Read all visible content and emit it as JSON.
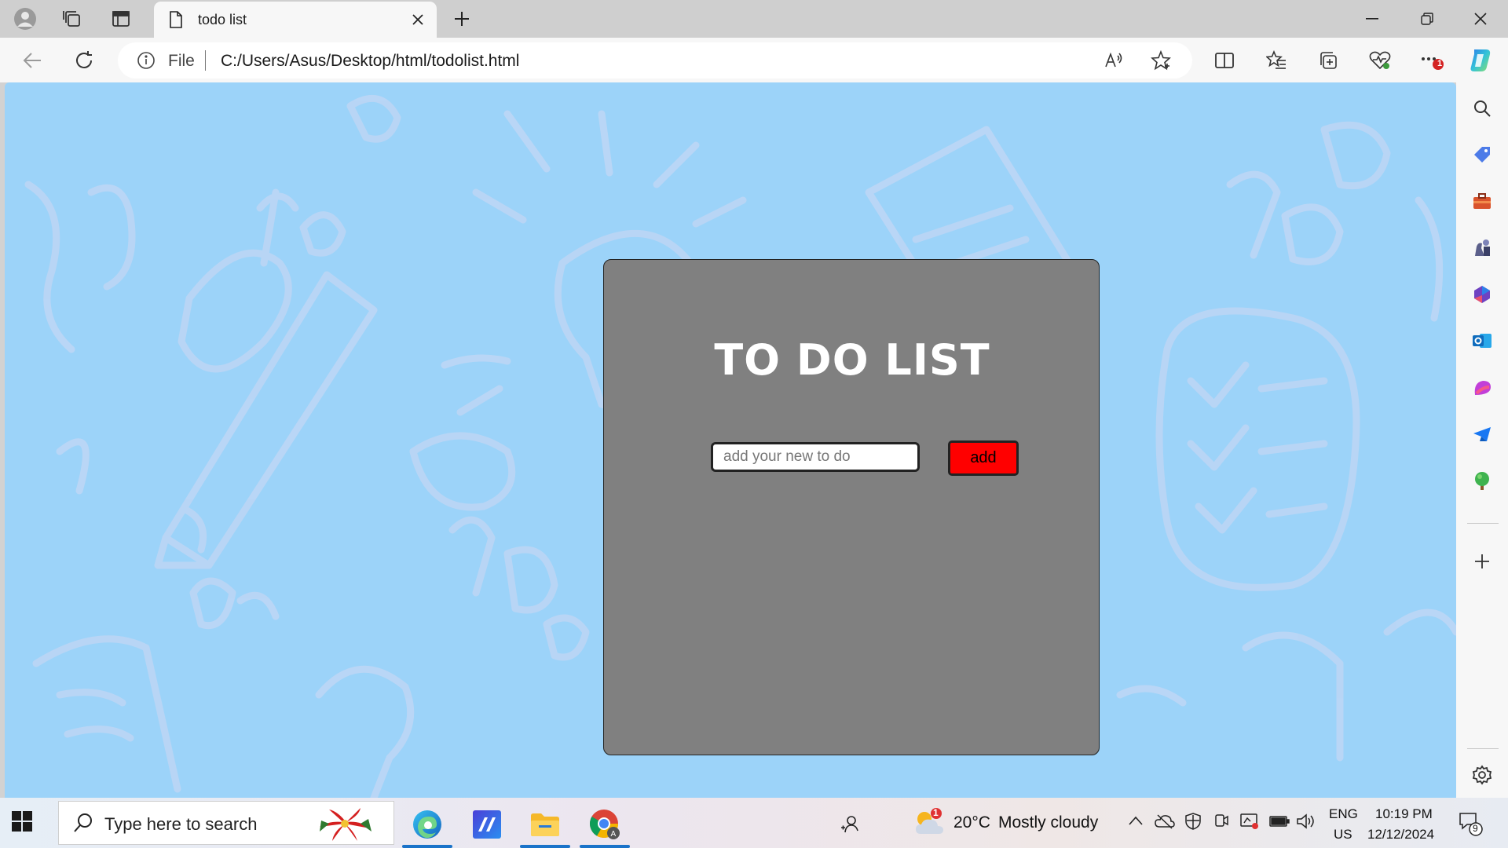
{
  "browser": {
    "tab_title": "todo list",
    "address_prefix": "File",
    "url": "C:/Users/Asus/Desktop/html/todolist.html",
    "notification_badge": "1"
  },
  "page": {
    "title": "TO DO LIST",
    "input_placeholder": "add your new to do",
    "add_label": "add",
    "colors": {
      "background": "#9cd3f9",
      "card": "#808080",
      "add_button": "#ff0000"
    }
  },
  "taskbar": {
    "search_placeholder": "Type here to search",
    "weather_temp": "20°C",
    "weather_desc": "Mostly cloudy",
    "weather_badge": "1",
    "language": "ENG",
    "region": "US",
    "time": "10:19 PM",
    "date": "12/12/2024",
    "notification_count": "9"
  },
  "icons": {
    "tabstrip": [
      "profile-icon",
      "workspaces-icon",
      "vertical-tabs-icon",
      "page-icon",
      "close-icon",
      "new-tab-icon"
    ],
    "window": [
      "minimize-icon",
      "restore-icon",
      "close-window-icon"
    ],
    "toolbar": [
      "back-icon",
      "refresh-icon",
      "info-icon",
      "read-aloud-icon",
      "favorite-star-icon",
      "split-screen-icon",
      "favorites-icon",
      "collections-icon",
      "browser-essentials-icon",
      "more-icon",
      "copilot-icon"
    ],
    "sidebar": [
      "search-icon",
      "shopping-icon",
      "tools-icon",
      "games-icon",
      "microsoft365-icon",
      "outlook-icon",
      "designer-icon",
      "telegram-icon",
      "tree-icon",
      "add-icon",
      "settings-icon"
    ],
    "taskbar": [
      "windows-start-icon",
      "search-icon",
      "poinsettia-icon",
      "edge-icon",
      "ai-app-icon",
      "file-explorer-icon",
      "chrome-icon",
      "people-icon",
      "weather-icon",
      "chevron-up-icon",
      "onedrive-icon",
      "security-icon",
      "meet-icon",
      "display-icon",
      "battery-icon",
      "volume-icon",
      "notifications-icon"
    ]
  }
}
